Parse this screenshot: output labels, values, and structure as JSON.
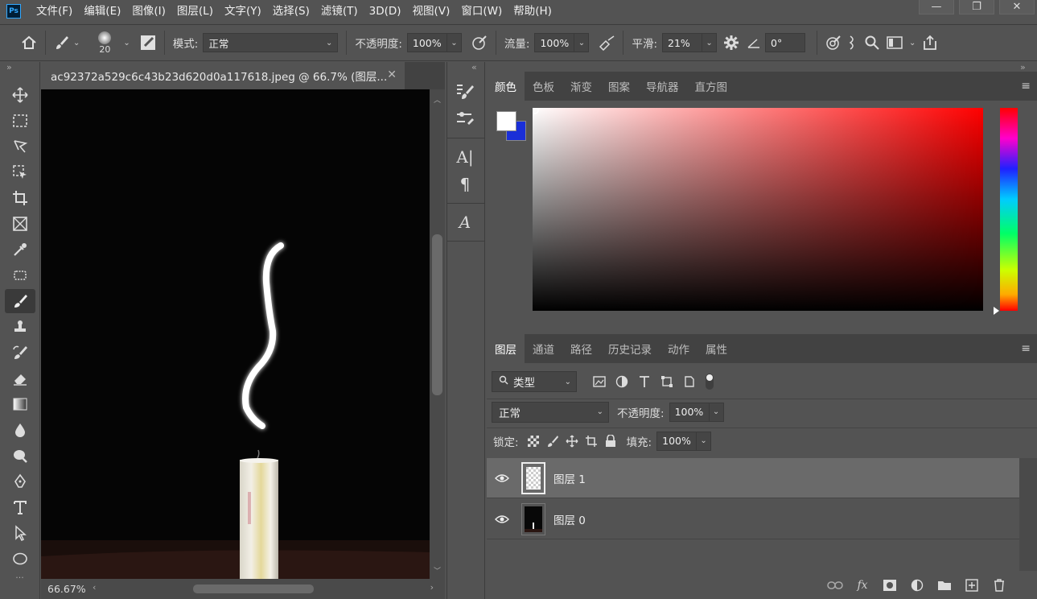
{
  "app": {
    "logo": "Ps"
  },
  "menu": [
    "文件(F)",
    "编辑(E)",
    "图像(I)",
    "图层(L)",
    "文字(Y)",
    "选择(S)",
    "滤镜(T)",
    "3D(D)",
    "视图(V)",
    "窗口(W)",
    "帮助(H)"
  ],
  "window_controls": {
    "minimize": "—",
    "restore": "❐",
    "close": "✕"
  },
  "options": {
    "brush_size": "20",
    "mode_label": "模式:",
    "mode_value": "正常",
    "opacity_label": "不透明度:",
    "opacity_value": "100%",
    "flow_label": "流量:",
    "flow_value": "100%",
    "smoothing_label": "平滑:",
    "smoothing_value": "21%",
    "angle_value": "0°"
  },
  "document": {
    "tab_title": "ac92372a529c6c43b23d620d0a117618.jpeg @ 66.7% (图层...",
    "zoom": "66.67%"
  },
  "color_panel": {
    "tabs": [
      "颜色",
      "色板",
      "渐变",
      "图案",
      "导航器",
      "直方图"
    ],
    "foreground": "#ffffff",
    "background": "#1a2fd8",
    "hue": "#ff0000"
  },
  "layers_panel": {
    "tabs": [
      "图层",
      "通道",
      "路径",
      "历史记录",
      "动作",
      "属性"
    ],
    "filter_label": "类型",
    "blend_mode": "正常",
    "opacity_label": "不透明度:",
    "opacity_value": "100%",
    "lock_label": "锁定:",
    "fill_label": "填充:",
    "fill_value": "100%",
    "layers": [
      {
        "name": "图层 1",
        "selected": true
      },
      {
        "name": "图层 0",
        "selected": false
      }
    ]
  }
}
